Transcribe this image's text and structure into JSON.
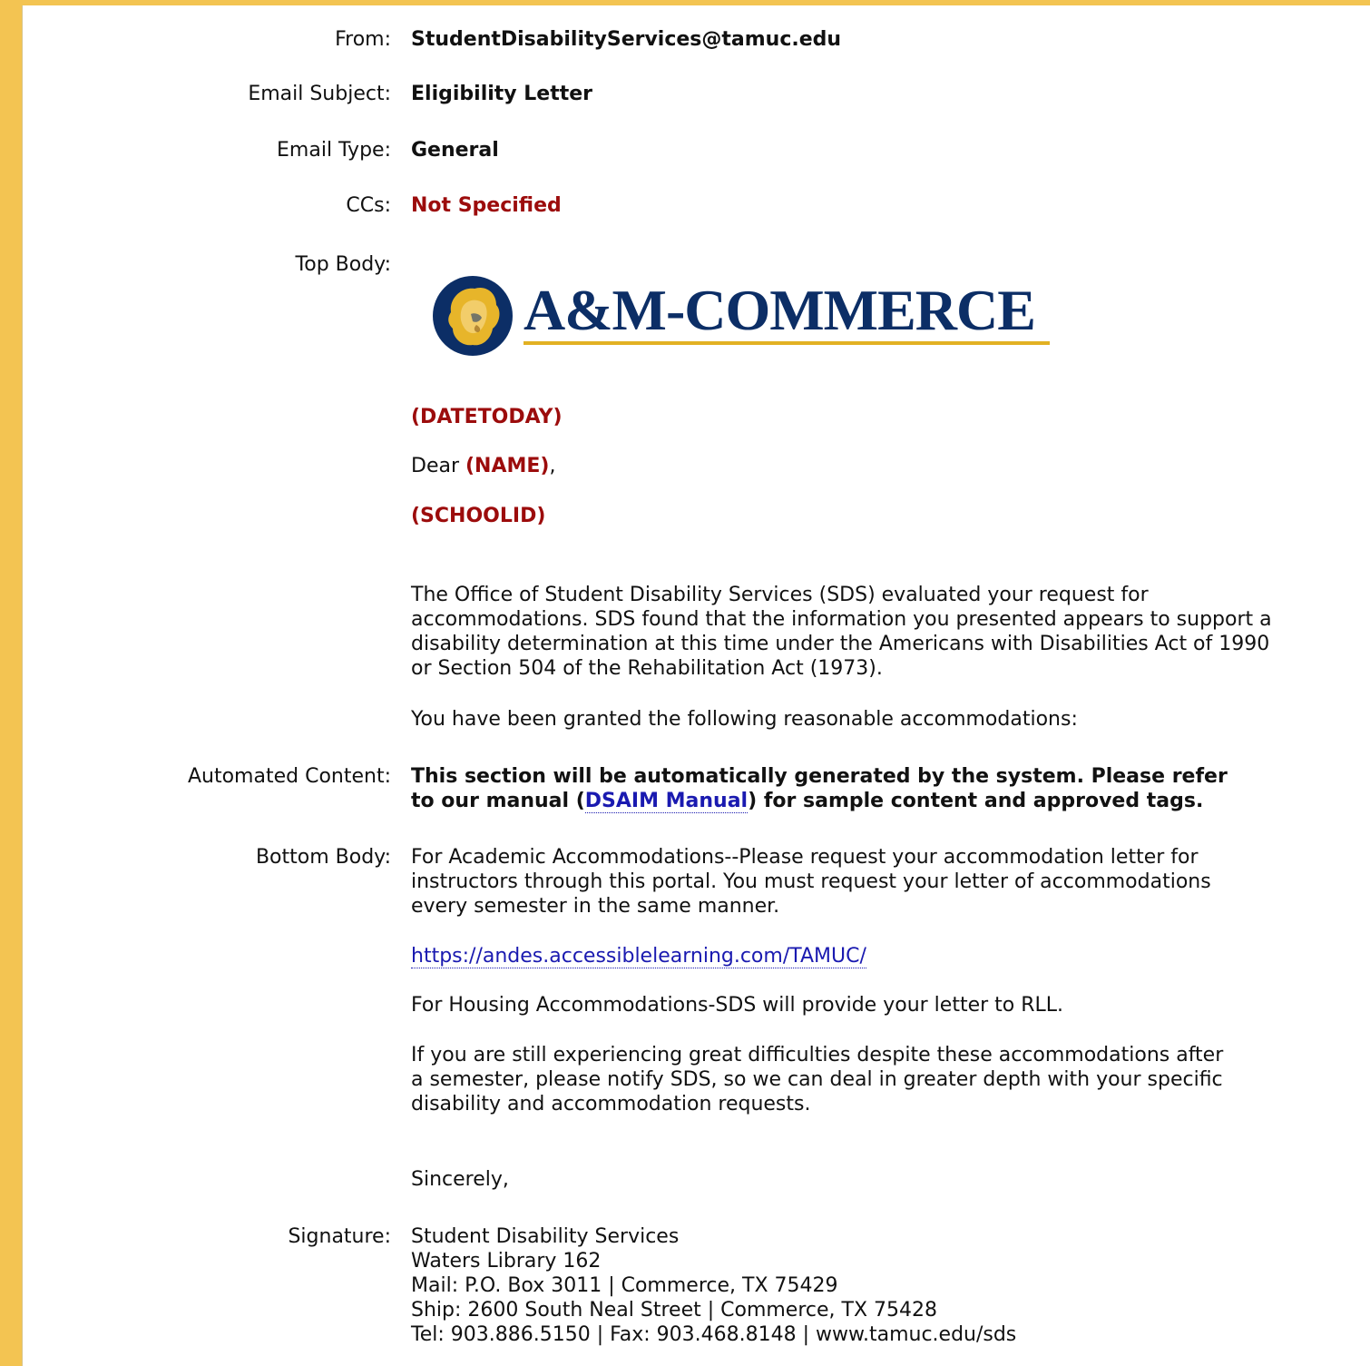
{
  "header": {
    "from": {
      "label": "From:",
      "value": "StudentDisabilityServices@tamuc.edu"
    },
    "subject": {
      "label": "Email Subject:",
      "value": "Eligibility Letter"
    },
    "type": {
      "label": "Email Type:",
      "value": "General"
    },
    "ccs": {
      "label": "CCs:",
      "value": "Not Specified"
    }
  },
  "top_body": {
    "label": "Top Body:",
    "logo_text": "A&M-COMMERCE",
    "date_tag": "(DATETODAY)",
    "dear": "Dear ",
    "name_tag": "(NAME)",
    "comma": ",",
    "school_id_tag": "(SCHOOLID)",
    "paragraph1": "The Office of Student Disability Services (SDS) evaluated your request for accommodations. SDS found that the information you presented appears to support a disability determination at this time under the Americans with Disabilities Act of 1990 or Section 504 of the Rehabilitation Act (1973).",
    "paragraph2": "You have been granted the following reasonable accommodations:"
  },
  "automated": {
    "label": "Automated Content:",
    "text_before": "This section will be automatically generated by the system. Please refer to our manual (",
    "link": "DSAIM Manual",
    "text_after": ") for sample content and approved tags."
  },
  "bottom_body": {
    "label": "Bottom Body:",
    "paragraph1": "For Academic Accommodations--Please request your accommodation letter for instructors through this portal. You must request your letter of accommodations every semester in the same manner.",
    "url": "https://andes.accessiblelearning.com/TAMUC/",
    "paragraph2": "For Housing Accommodations-SDS will provide your letter to RLL.",
    "paragraph3": "If you are still experiencing great difficulties despite these accommodations after a semester, please notify SDS, so we can deal in greater depth with your specific disability and accommodation requests.",
    "closing": "Sincerely,"
  },
  "signature": {
    "label": "Signature:",
    "lines": [
      "Student Disability Services",
      "Waters Library 162",
      "Mail: P.O. Box 3011 | Commerce, TX 75429",
      "Ship: 2600 South Neal Street | Commerce, TX 75428",
      "Tel: 903.886.5150 | Fax: 903.468.8148 | www.tamuc.edu/sds"
    ]
  },
  "colors": {
    "frame": "#f3c452",
    "placeholder_red": "#9c0c0c",
    "logo_blue": "#0c2e66",
    "logo_gold": "#e2b123",
    "link_blue": "#1a1ab0"
  }
}
